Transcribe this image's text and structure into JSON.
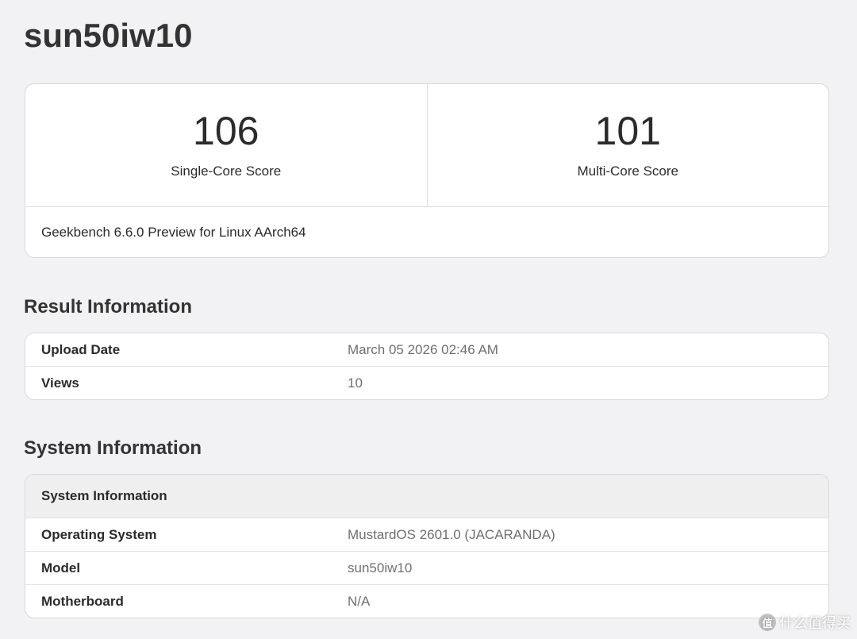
{
  "page": {
    "title": "sun50iw10"
  },
  "scores": {
    "single_core_value": "106",
    "single_core_label": "Single-Core Score",
    "multi_core_value": "101",
    "multi_core_label": "Multi-Core Score",
    "version": "Geekbench 6.6.0 Preview for Linux AArch64"
  },
  "result_information": {
    "title": "Result Information",
    "rows": [
      {
        "key": "Upload Date",
        "value": "March 05 2026 02:46 AM"
      },
      {
        "key": "Views",
        "value": "10"
      }
    ]
  },
  "system_information": {
    "title": "System Information",
    "table_header": "System Information",
    "rows": [
      {
        "key": "Operating System",
        "value": "MustardOS 2601.0 (JACARANDA)"
      },
      {
        "key": "Model",
        "value": "sun50iw10"
      },
      {
        "key": "Motherboard",
        "value": "N/A"
      }
    ]
  },
  "watermark": {
    "icon_text": "值",
    "text": "什么值得买"
  }
}
